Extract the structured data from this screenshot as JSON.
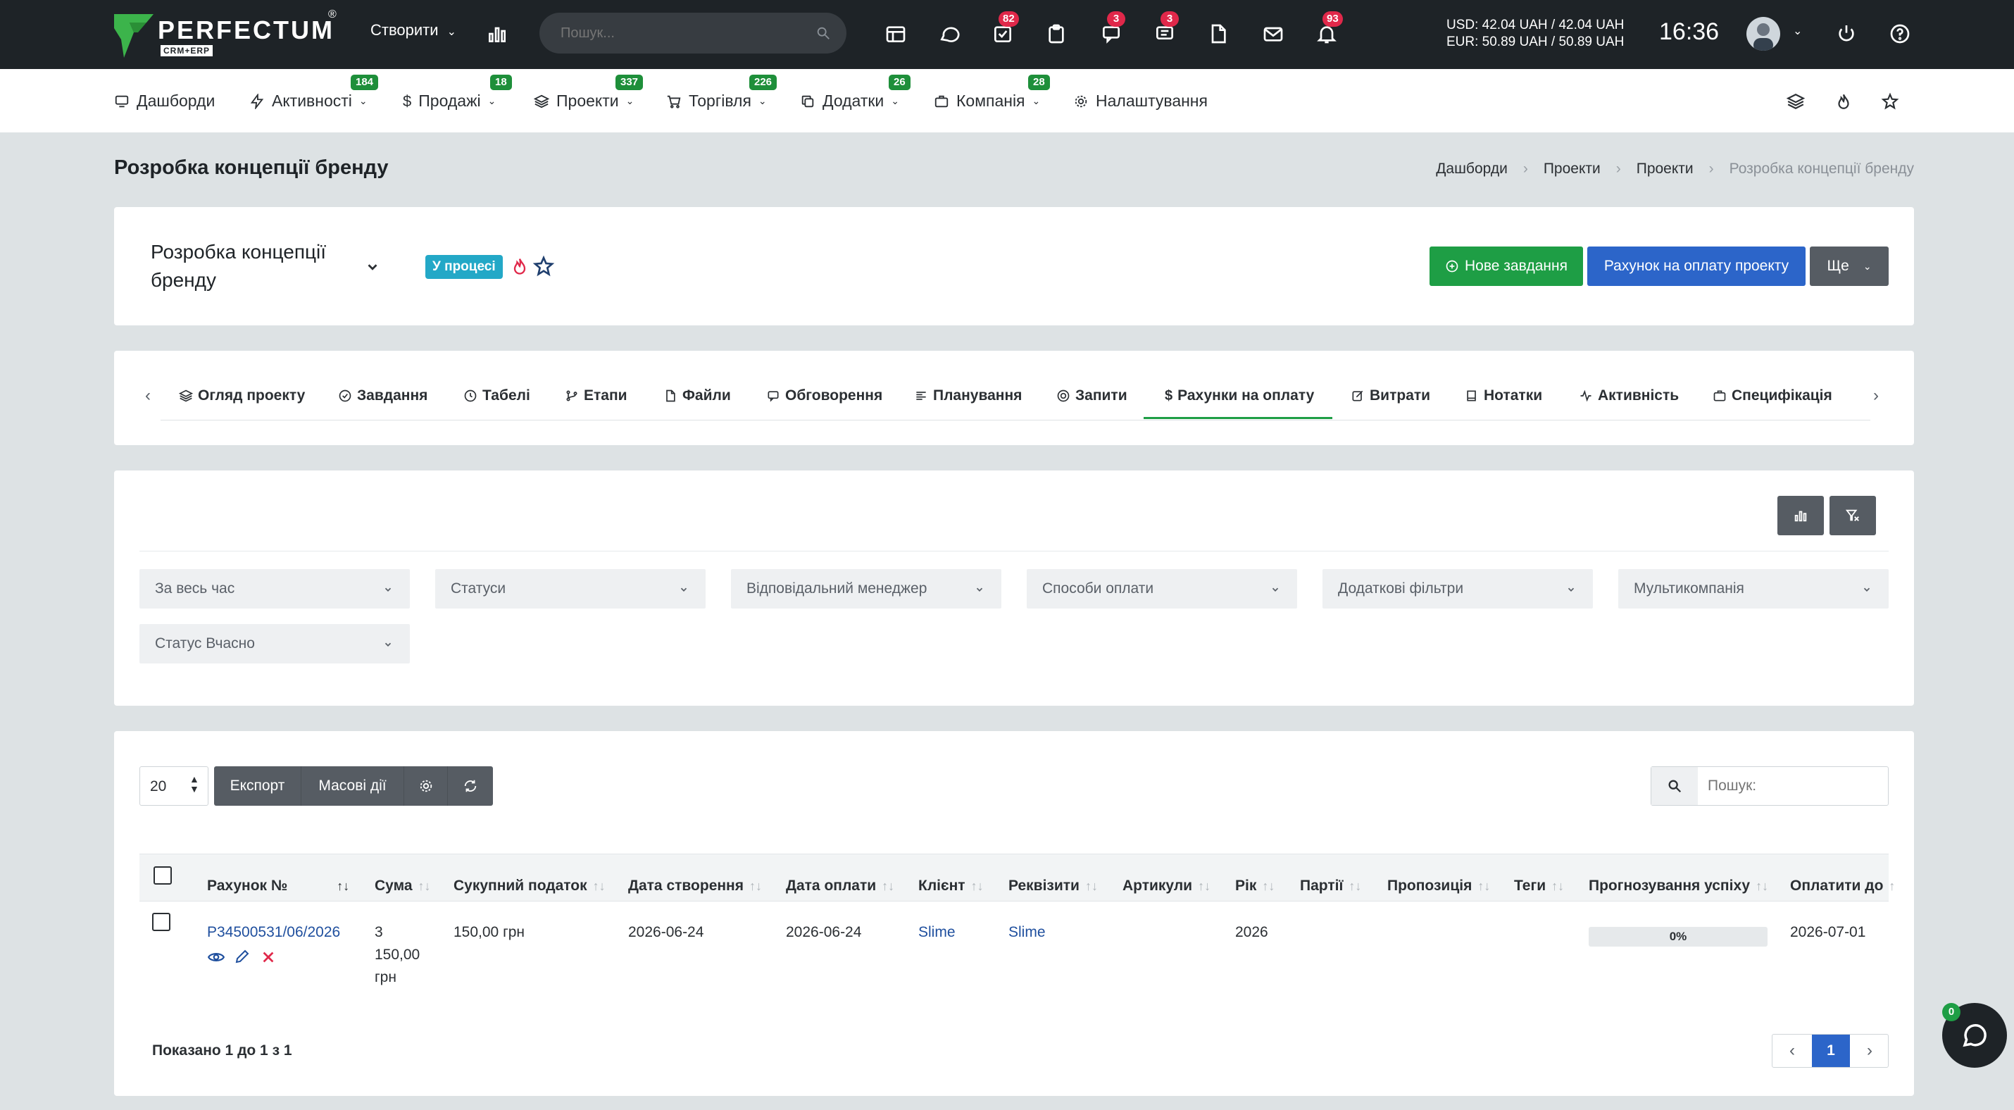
{
  "topbar": {
    "logo_text": "PERFECTUM",
    "logo_reg": "®",
    "logo_sub": "CRM+ERP",
    "create_label": "Створити",
    "search_placeholder": "Пошук...",
    "badges": {
      "tasks": "82",
      "chat": "3",
      "messages": "3",
      "notifications": "93"
    },
    "currency_usd": "USD: 42.04 UAH / 42.04 UAH",
    "currency_eur": "EUR: 50.89 UAH / 50.89 UAH",
    "time": "16:36"
  },
  "nav": {
    "items": [
      {
        "label": "Дашборди",
        "badge": ""
      },
      {
        "label": "Активності",
        "badge": "184"
      },
      {
        "label": "Продажі",
        "badge": "18"
      },
      {
        "label": "Проекти",
        "badge": "337"
      },
      {
        "label": "Торгівля",
        "badge": "226"
      },
      {
        "label": "Додатки",
        "badge": "26"
      },
      {
        "label": "Компанія",
        "badge": "28"
      },
      {
        "label": "Налаштування",
        "badge": ""
      }
    ]
  },
  "page": {
    "title": "Розробка концепції бренду",
    "breadcrumb": [
      "Дашборди",
      "Проекти",
      "Проекти",
      "Розробка концепції бренду"
    ]
  },
  "project": {
    "name": "Розробка концепції бренду",
    "status": "У процесі",
    "btn_new_task": "Нове завдання",
    "btn_invoice": "Рахунок на оплату проекту",
    "btn_more": "Ще"
  },
  "tabs": [
    "Огляд проекту",
    "Завдання",
    "Табелі",
    "Етапи",
    "Файли",
    "Обговорення",
    "Планування",
    "Запити",
    "Рахунки на оплату",
    "Витрати",
    "Нотатки",
    "Активність",
    "Специфікація"
  ],
  "filters": [
    "За весь час",
    "Статуси",
    "Відповідальний менеджер",
    "Способи оплати",
    "Додаткові фільтри",
    "Мультикомпанія",
    "Статус Вчасно"
  ],
  "table": {
    "page_size": "20",
    "export_label": "Експорт",
    "bulk_label": "Масові дії",
    "search_placeholder": "Пошук:",
    "columns": [
      "Рахунок №",
      "Сума",
      "Сукупний податок",
      "Дата створення",
      "Дата оплати",
      "Клієнт",
      "Реквізити",
      "Артикули",
      "Рік",
      "Партії",
      "Пропозиція",
      "Теги",
      "Прогнозування успіху",
      "Оплатити до"
    ],
    "rows": [
      {
        "number": "P34500531/06/2026",
        "sum_line1": "3",
        "sum_line2": "150,00",
        "sum_line3": "грн",
        "tax": "150,00 грн",
        "created": "2026-06-24",
        "paid": "2026-06-24",
        "client": "Slime",
        "requisites": "Slime",
        "articles": "",
        "year": "2026",
        "batches": "",
        "offer": "",
        "tags": "",
        "forecast": "0%",
        "due": "2026-07-01"
      }
    ],
    "summary": "Показано 1 до 1 з 1",
    "current_page": "1"
  },
  "chat_badge": "0"
}
